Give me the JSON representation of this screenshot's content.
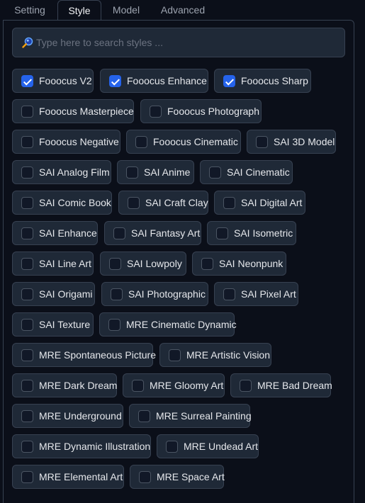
{
  "tabs": [
    {
      "label": "Setting",
      "active": false
    },
    {
      "label": "Style",
      "active": true
    },
    {
      "label": "Model",
      "active": false
    },
    {
      "label": "Advanced",
      "active": false
    }
  ],
  "search": {
    "placeholder": "Type here to search styles ...",
    "value": "",
    "icon": "search-icon"
  },
  "colors": {
    "accent": "#2563eb",
    "background": "#0b0f19",
    "chip": "#1f2937",
    "border": "#374151"
  },
  "styles": [
    {
      "label": "Fooocus V2",
      "checked": true
    },
    {
      "label": "Fooocus Enhance",
      "checked": true
    },
    {
      "label": "Fooocus Sharp",
      "checked": true
    },
    {
      "label": "Fooocus Masterpiece",
      "checked": false
    },
    {
      "label": "Fooocus Photograph",
      "checked": false
    },
    {
      "label": "Fooocus Negative",
      "checked": false
    },
    {
      "label": "Fooocus Cinematic",
      "checked": false
    },
    {
      "label": "SAI 3D Model",
      "checked": false
    },
    {
      "label": "SAI Analog Film",
      "checked": false
    },
    {
      "label": "SAI Anime",
      "checked": false
    },
    {
      "label": "SAI Cinematic",
      "checked": false
    },
    {
      "label": "SAI Comic Book",
      "checked": false
    },
    {
      "label": "SAI Craft Clay",
      "checked": false
    },
    {
      "label": "SAI Digital Art",
      "checked": false
    },
    {
      "label": "SAI Enhance",
      "checked": false
    },
    {
      "label": "SAI Fantasy Art",
      "checked": false
    },
    {
      "label": "SAI Isometric",
      "checked": false
    },
    {
      "label": "SAI Line Art",
      "checked": false
    },
    {
      "label": "SAI Lowpoly",
      "checked": false
    },
    {
      "label": "SAI Neonpunk",
      "checked": false
    },
    {
      "label": "SAI Origami",
      "checked": false
    },
    {
      "label": "SAI Photographic",
      "checked": false
    },
    {
      "label": "SAI Pixel Art",
      "checked": false
    },
    {
      "label": "SAI Texture",
      "checked": false
    },
    {
      "label": "MRE Cinematic Dynamic",
      "checked": false
    },
    {
      "label": "MRE Spontaneous Picture",
      "checked": false
    },
    {
      "label": "MRE Artistic Vision",
      "checked": false
    },
    {
      "label": "MRE Dark Dream",
      "checked": false
    },
    {
      "label": "MRE Gloomy Art",
      "checked": false
    },
    {
      "label": "MRE Bad Dream",
      "checked": false
    },
    {
      "label": "MRE Underground",
      "checked": false
    },
    {
      "label": "MRE Surreal Painting",
      "checked": false
    },
    {
      "label": "MRE Dynamic Illustration",
      "checked": false
    },
    {
      "label": "MRE Undead Art",
      "checked": false
    },
    {
      "label": "MRE Elemental Art",
      "checked": false
    },
    {
      "label": "MRE Space Art",
      "checked": false
    }
  ]
}
